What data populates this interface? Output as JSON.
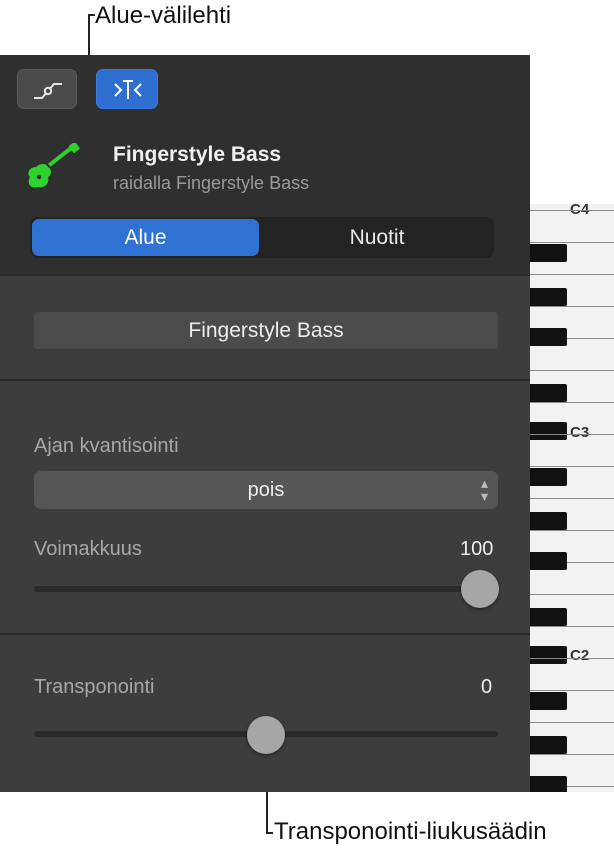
{
  "callouts": {
    "region_tab": "Alue-välilehti",
    "transpose_slider": "Transponointi-liukusäädin"
  },
  "toolbar": {
    "automation_icon": "automation-curve-icon",
    "region_icon": "region-inspector-icon"
  },
  "track": {
    "icon": "bass-guitar-icon",
    "icon_color": "#2fd12f",
    "name": "Fingerstyle Bass",
    "subtitle": "raidalla Fingerstyle Bass"
  },
  "tabs": [
    {
      "label": "Alue",
      "selected": true
    },
    {
      "label": "Nuotit",
      "selected": false
    }
  ],
  "region": {
    "name": "Fingerstyle Bass"
  },
  "quantize": {
    "label": "Ajan kvantisointi",
    "value": "pois"
  },
  "velocity": {
    "label": "Voimakkuus",
    "value": "100",
    "level": 1.0
  },
  "transpose": {
    "label": "Transponointi",
    "value": "0",
    "level": 0.5
  },
  "keyboard": {
    "octaves": [
      "C4",
      "C3",
      "C2"
    ]
  },
  "colors": {
    "accent": "#2f72d1",
    "panel_bg": "#3d3d3d",
    "header_bg": "#2f2f2f"
  }
}
